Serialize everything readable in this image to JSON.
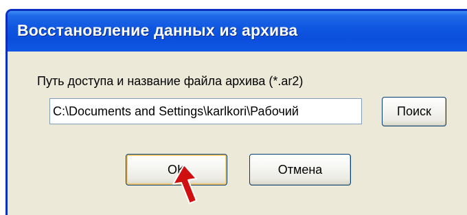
{
  "dialog": {
    "title": "Восстановление данных из архива",
    "path_label": "Путь доступа и название файла архива (*.ar2)",
    "path_value": "C:\\Documents and Settings\\karlkori\\Рабочий",
    "search_label": "Поиск",
    "ok_label": "OK",
    "cancel_label": "Отмена"
  },
  "colors": {
    "titlebar": "#0b4fdc",
    "dialog_bg": "#ece9d8",
    "cursor": "#d01010"
  },
  "icons": {
    "cursor": "red-arrow-cursor-icon"
  }
}
